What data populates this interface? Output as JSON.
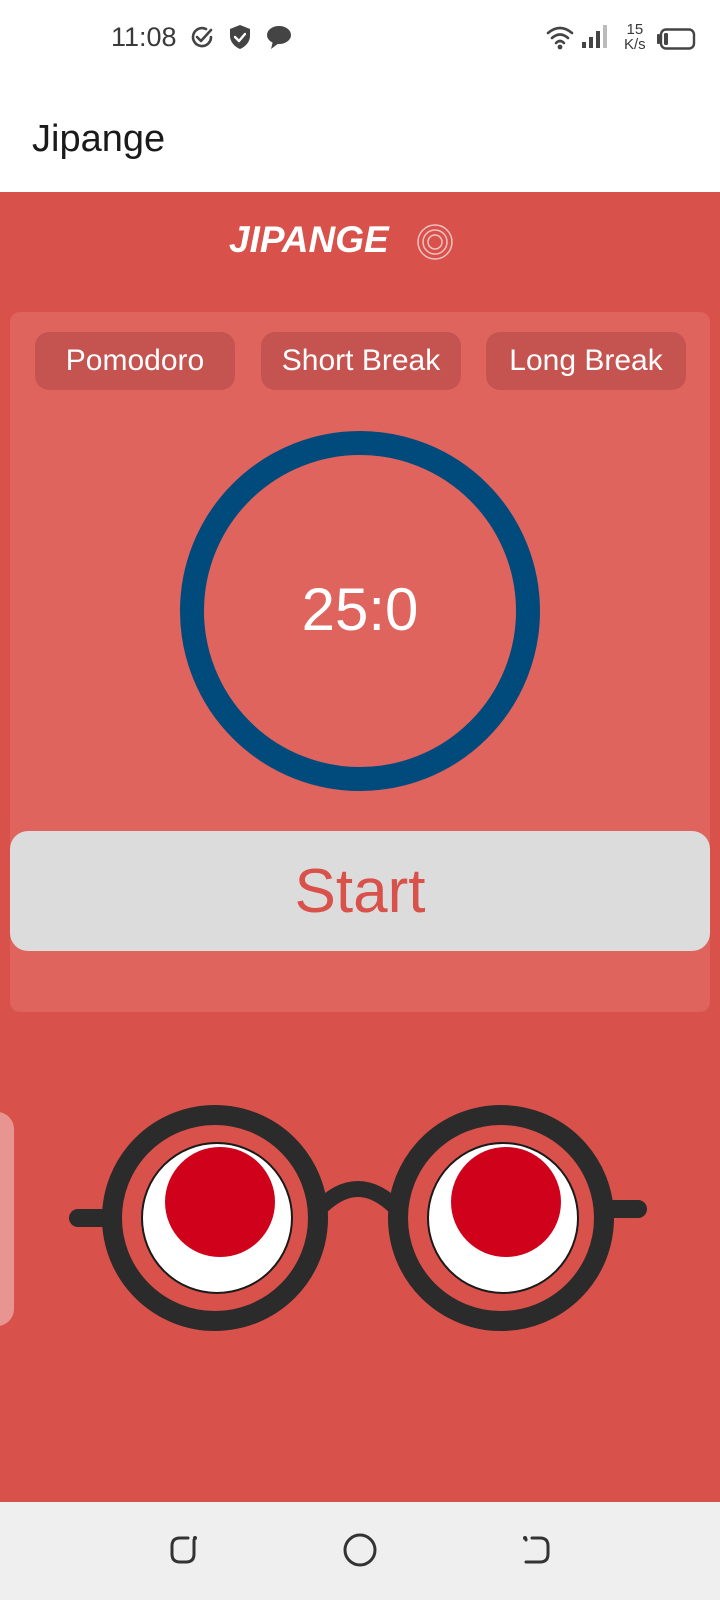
{
  "status_bar": {
    "time": "11:08",
    "net_speed_value": "15",
    "net_speed_unit": "K/s",
    "icons": [
      "check-circle-icon",
      "shield-icon",
      "chat-bubble-icon",
      "wifi-icon",
      "signal-icon",
      "battery-icon"
    ]
  },
  "app_bar": {
    "title": "Jipange"
  },
  "header": {
    "brand": "JIPANGE",
    "brand_icon": "target-icon"
  },
  "tabs": [
    {
      "label": "Pomodoro"
    },
    {
      "label": "Short Break"
    },
    {
      "label": "Long Break"
    }
  ],
  "timer": {
    "display": "25:0",
    "progress": 1.0
  },
  "controls": {
    "start_label": "Start"
  },
  "colors": {
    "background": "#d9514b",
    "card": "#df645e",
    "tab": "#c55450",
    "ring": "#004a7c",
    "button": "#dcdcdc",
    "button_text": "#d9514b",
    "eye_pupil": "#d0021b"
  },
  "nav_bar": {
    "icons": [
      "recents-icon",
      "home-icon",
      "back-icon"
    ]
  }
}
